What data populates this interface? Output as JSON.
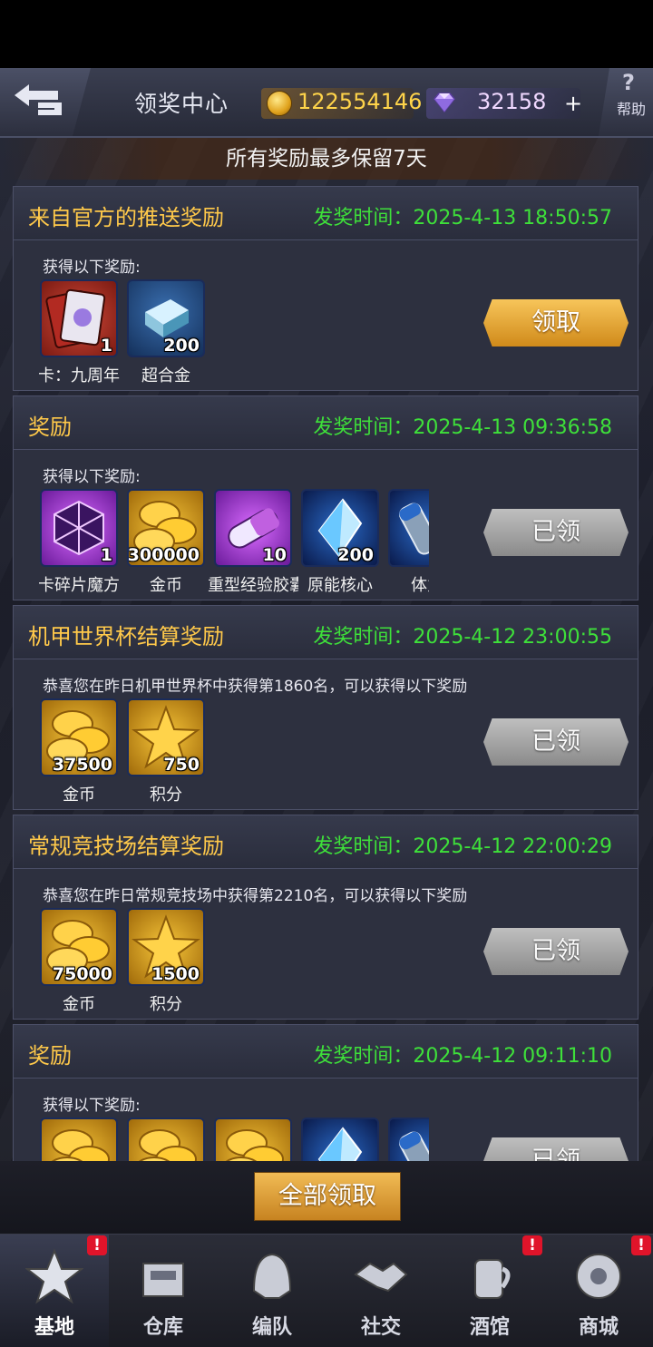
{
  "header": {
    "title": "领奖中心",
    "coins": "122554146",
    "gems": "32158",
    "plus": "+",
    "help_glyph": "?",
    "help_label": "帮助",
    "back_icon": "back-arrow-icon",
    "coin_icon": "gold-coin-icon",
    "gem_icon": "diamond-icon"
  },
  "notice": "所有奖励最多保留7天",
  "rewards": [
    {
      "title": "来自官方的推送奖励",
      "time": "发奖时间：2025-4-13 18:50:57",
      "desc": "获得以下奖励:",
      "button": "领取",
      "claimed": false,
      "items": [
        {
          "icon": "anniversary-card-icon",
          "count": "1",
          "name": "卡：九周年"
        },
        {
          "icon": "super-alloy-icon",
          "count": "200",
          "name": "超合金"
        }
      ]
    },
    {
      "title": "奖励",
      "time": "发奖时间：2025-4-13 09:36:58",
      "desc": "获得以下奖励:",
      "button": "已领",
      "claimed": true,
      "items": [
        {
          "icon": "fragment-cube-icon",
          "count": "1",
          "name": "卡碎片魔方"
        },
        {
          "icon": "gold-coins-icon",
          "count": "300000",
          "name": "金币"
        },
        {
          "icon": "exp-capsule-icon",
          "count": "10",
          "name": "重型经验胶囊"
        },
        {
          "icon": "energy-core-icon",
          "count": "200",
          "name": "原能核心"
        },
        {
          "icon": "stamina-icon",
          "count": "",
          "name": "体力"
        }
      ]
    },
    {
      "title": "机甲世界杯结算奖励",
      "time": "发奖时间：2025-4-12 23:00:55",
      "desc": "恭喜您在昨日机甲世界杯中获得第1860名，可以获得以下奖励",
      "button": "已领",
      "claimed": true,
      "items": [
        {
          "icon": "gold-coins-icon",
          "count": "37500",
          "name": "金币"
        },
        {
          "icon": "star-points-icon",
          "count": "750",
          "name": "积分"
        }
      ]
    },
    {
      "title": "常规竞技场结算奖励",
      "time": "发奖时间：2025-4-12 22:00:29",
      "desc": "恭喜您在昨日常规竞技场中获得第2210名，可以获得以下奖励",
      "button": "已领",
      "claimed": true,
      "items": [
        {
          "icon": "gold-coins-icon",
          "count": "75000",
          "name": "金币"
        },
        {
          "icon": "star-points-icon",
          "count": "1500",
          "name": "积分"
        }
      ]
    },
    {
      "title": "奖励",
      "time": "发奖时间：2025-4-12 09:11:10",
      "desc": "获得以下奖励:",
      "button": "已领",
      "claimed": true,
      "items": [
        {
          "icon": "gold-coins-icon",
          "count": "",
          "name": ""
        },
        {
          "icon": "gold-coins-icon",
          "count": "",
          "name": ""
        },
        {
          "icon": "gold-coins-icon",
          "count": "",
          "name": ""
        },
        {
          "icon": "energy-core-icon",
          "count": "",
          "name": ""
        },
        {
          "icon": "stamina-icon",
          "count": "",
          "name": ""
        }
      ]
    }
  ],
  "claim_all": "全部领取",
  "nav": [
    {
      "label": "基地",
      "icon": "base-star-icon",
      "badge": "!",
      "active": true
    },
    {
      "label": "仓库",
      "icon": "warehouse-icon",
      "badge": "",
      "active": false
    },
    {
      "label": "编队",
      "icon": "formation-helmet-icon",
      "badge": "",
      "active": false
    },
    {
      "label": "社交",
      "icon": "handshake-icon",
      "badge": "",
      "active": false
    },
    {
      "label": "酒馆",
      "icon": "tavern-icon",
      "badge": "!",
      "active": false
    },
    {
      "label": "商城",
      "icon": "shop-robot-icon",
      "badge": "!",
      "active": false
    }
  ],
  "colors": {
    "title_gold": "#ffc94a",
    "time_green": "#3ee03a",
    "claim_button": "#e4a53a",
    "claimed_button": "#a5a5a5",
    "badge_red": "#e0142a"
  }
}
